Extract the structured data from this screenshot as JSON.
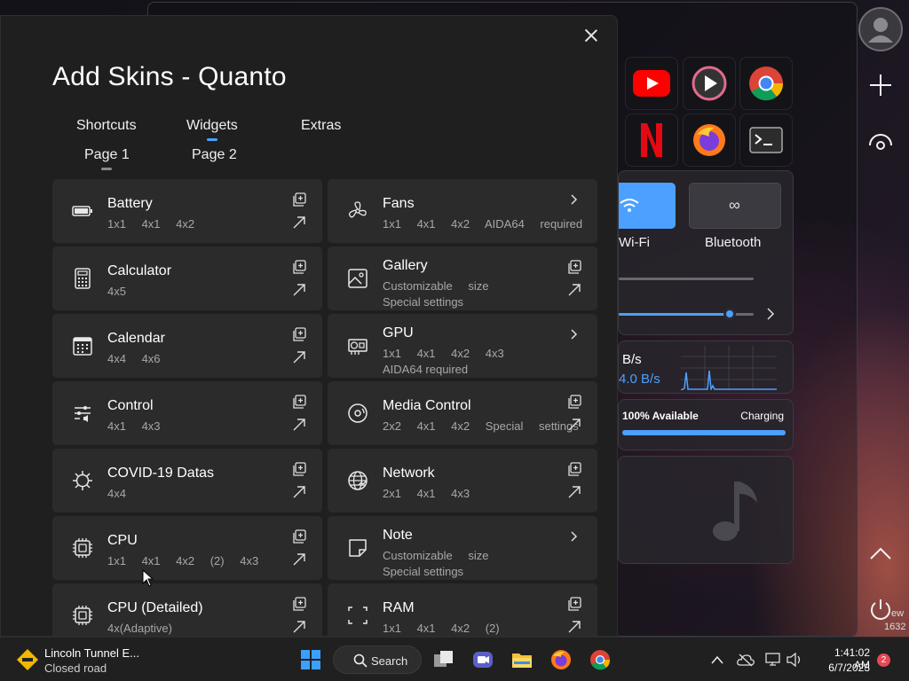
{
  "dialog": {
    "title": "Add Skins - Quanto",
    "tabs": [
      {
        "label": "Shortcuts",
        "active": false
      },
      {
        "label": "Widgets",
        "active": true
      },
      {
        "label": "Extras",
        "active": false
      }
    ],
    "pages": [
      {
        "label": "Page 1",
        "active": true
      },
      {
        "label": "Page 2",
        "active": false
      }
    ],
    "left_column": [
      {
        "name": "Battery",
        "sizes": "1x1 4x1 4x2",
        "note": "",
        "icon": "battery-icon",
        "action": "add"
      },
      {
        "name": "Calculator",
        "sizes": "4x5",
        "note": "",
        "icon": "calculator-icon",
        "action": "add"
      },
      {
        "name": "Calendar",
        "sizes": "4x4 4x6",
        "note": "",
        "icon": "calendar-icon",
        "action": "add"
      },
      {
        "name": "Control",
        "sizes": "4x1 4x3",
        "note": "",
        "icon": "sliders-icon",
        "action": "add"
      },
      {
        "name": "COVID-19 Datas",
        "sizes": "4x4",
        "note": "",
        "icon": "virus-icon",
        "action": "add"
      },
      {
        "name": "CPU",
        "sizes": "1x1 4x1 4x2 (2) 4x3",
        "note": "",
        "icon": "chip-icon",
        "action": "add"
      },
      {
        "name": "CPU (Detailed)",
        "sizes": "4x(Adaptive)",
        "note": "",
        "icon": "chip-icon",
        "action": "add"
      }
    ],
    "right_column": [
      {
        "name": "Fans",
        "sizes": "1x1 4x1 4x2 AIDA64 required",
        "note": "",
        "icon": "fan-icon",
        "action": "expand"
      },
      {
        "name": "Gallery",
        "sizes": "Customizable size",
        "note": "Special settings",
        "icon": "image-icon",
        "action": "add"
      },
      {
        "name": "GPU",
        "sizes": "1x1 4x1 4x2 4x3",
        "note": "AIDA64 required",
        "icon": "gpu-icon",
        "action": "expand"
      },
      {
        "name": "Media Control",
        "sizes": "2x2 4x1 4x2 Special settings",
        "note": "",
        "icon": "disc-icon",
        "action": "add"
      },
      {
        "name": "Network",
        "sizes": "2x1 4x1 4x3",
        "note": "",
        "icon": "globe-icon",
        "action": "add"
      },
      {
        "name": "Note",
        "sizes": "Customizable size",
        "note": "Special settings",
        "icon": "note-icon",
        "action": "expand"
      },
      {
        "name": "RAM",
        "sizes": "1x1 4x1 4x2 (2)",
        "note": "",
        "icon": "ram-icon",
        "action": "add"
      }
    ]
  },
  "quanto": {
    "wifi_label": "Wi-Fi",
    "bluetooth_label": "Bluetooth",
    "net_rate_1": "B/s",
    "net_rate_2": "4.0 B/s",
    "battery_status": "100% Available",
    "battery_state": "Charging",
    "battery_level": 1.0,
    "volume_level": 0.82,
    "rail_text_1": "ew",
    "rail_text_2": "1632"
  },
  "taskbar": {
    "widget_title": "Lincoln Tunnel E...",
    "widget_subtitle": "Closed road",
    "search_label": "Search",
    "time": "1:41:02 AM",
    "date": "6/7/2023",
    "notification_count": "2"
  },
  "colors": {
    "accent": "#4ca0ff",
    "tile_bg": "#2b2b2b",
    "dialog_bg": "#1f1f1f"
  }
}
